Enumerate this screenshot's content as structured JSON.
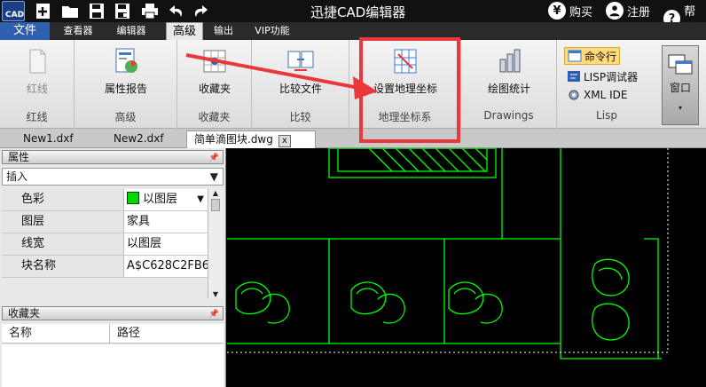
{
  "title_bar": {
    "logo_text": "CAD",
    "app_title": "迅捷CAD编辑器",
    "buy": "购买",
    "register": "注册",
    "help": "帮助",
    "buy_icon": "¥",
    "help_icon": "?"
  },
  "menu": {
    "file": "文件",
    "tabs": [
      "查看器",
      "编辑器",
      "高级",
      "输出",
      "VIP功能"
    ],
    "active": "高级"
  },
  "ribbon": {
    "groups": [
      {
        "button": "红线",
        "label": "红线"
      },
      {
        "button": "属性报告",
        "label": "高级"
      },
      {
        "button": "收藏夹",
        "label": "收藏夹"
      },
      {
        "button": "比较文件",
        "label": "比较"
      },
      {
        "button": "设置地理坐标",
        "label": "地理坐标系"
      },
      {
        "button": "绘图统计",
        "label": "Drawings"
      },
      {
        "label": "Lisp"
      }
    ],
    "lisp_items": [
      "命令行",
      "LISP调试器",
      "XML IDE"
    ],
    "window_label": "窗口"
  },
  "doc_tabs": [
    "New1.dxf",
    "New2.dxf",
    "简单滴图块.dwg"
  ],
  "doc_close": "x",
  "properties_panel": {
    "title": "属性",
    "selected": "插入",
    "rows": [
      {
        "name": "色彩",
        "value": "以图层"
      },
      {
        "name": "图层",
        "value": "家具"
      },
      {
        "name": "线宽",
        "value": "以图层"
      },
      {
        "name": "块名称",
        "value": "A$C628C2FB6"
      }
    ]
  },
  "favorites_panel": {
    "title": "收藏夹",
    "columns": [
      "名称",
      "路径"
    ]
  },
  "colors": {
    "accent_blue": "#2f5fb0",
    "highlight_red": "#e8383b",
    "cad_green": "#00ff00"
  }
}
